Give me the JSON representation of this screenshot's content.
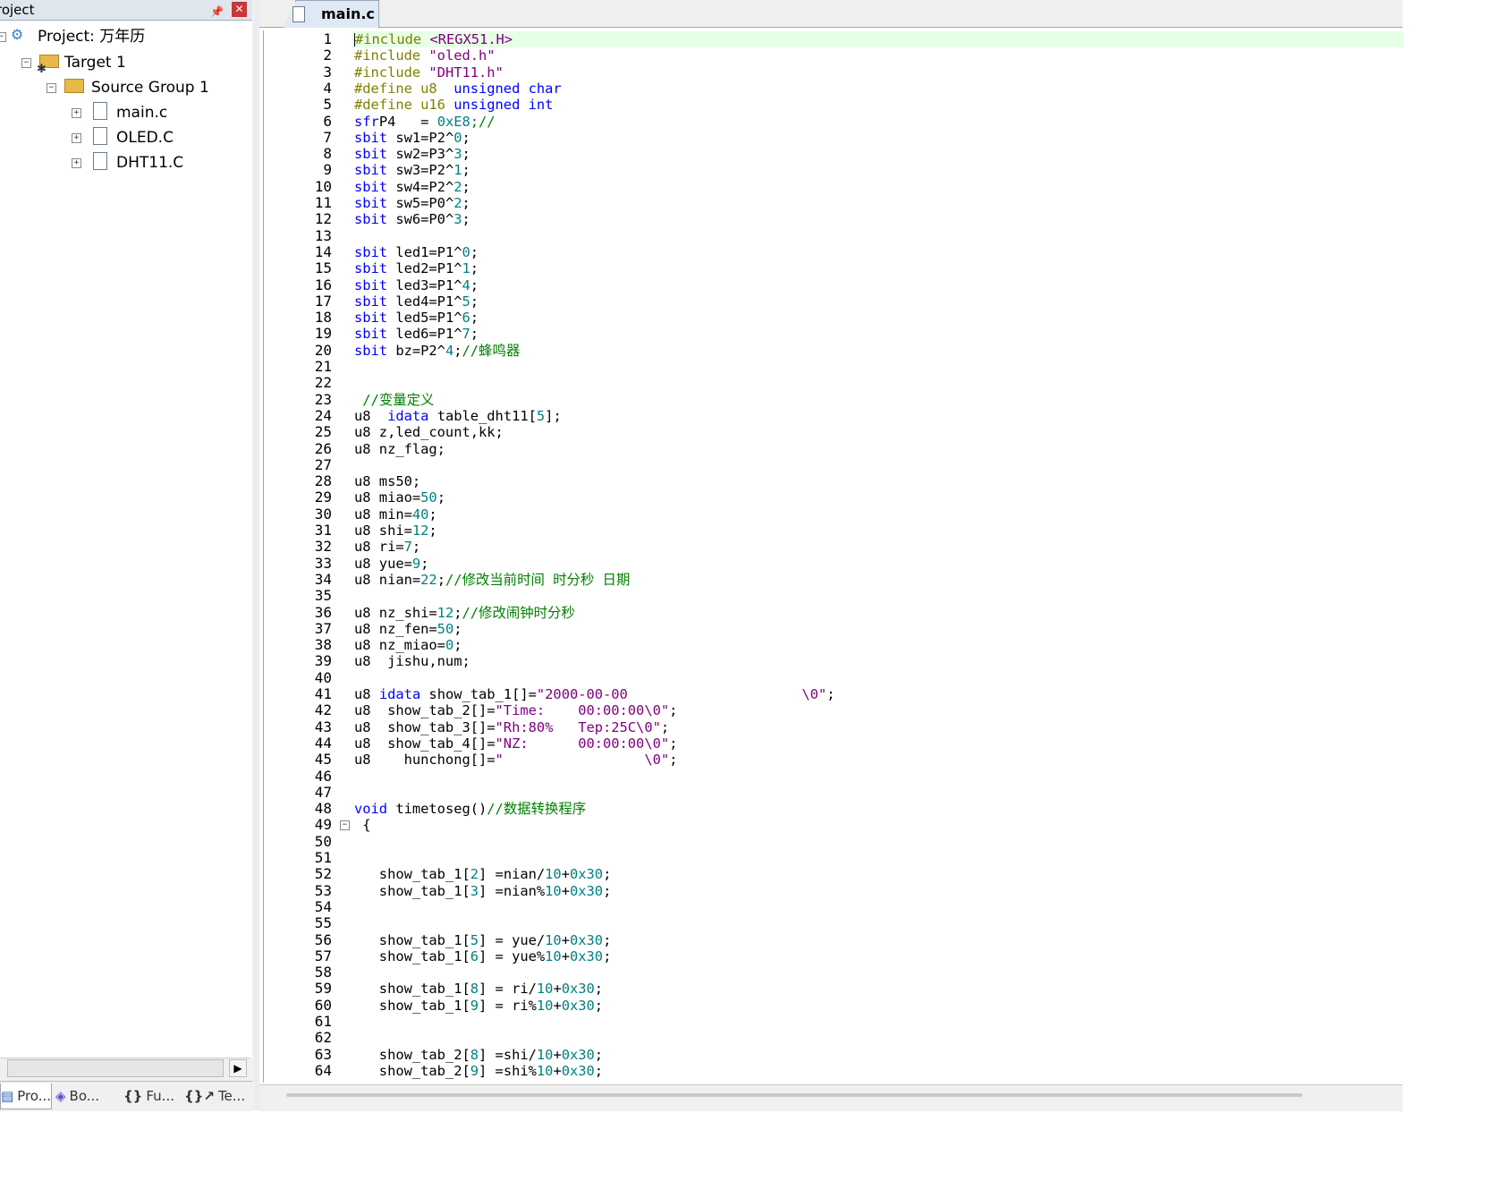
{
  "project_panel": {
    "title": "roject",
    "pin_icon": "pin-icon",
    "close_icon": "close-icon",
    "tree": {
      "project": "Project: 万年历",
      "target": "Target 1",
      "group": "Source Group 1",
      "files": [
        "main.c",
        "OLED.C",
        "DHT11.C"
      ]
    },
    "bottom_tabs": [
      "Pro...",
      "Bo...",
      "Fu...",
      "Te..."
    ],
    "bottom_tab_icons": [
      "project-icon",
      "books-icon",
      "functions-icon",
      "templates-icon"
    ]
  },
  "editor": {
    "tab": "main.c",
    "active_line": 1,
    "lines": [
      [
        [
          "pp",
          "#include "
        ],
        [
          "st",
          "<REGX51.H>"
        ]
      ],
      [
        [
          "pp",
          "#include "
        ],
        [
          "st",
          "\"oled.h\""
        ]
      ],
      [
        [
          "pp",
          "#include "
        ],
        [
          "st",
          "\"DHT11.h\""
        ]
      ],
      [
        [
          "pp",
          "#define u8  "
        ],
        [
          "kw",
          "unsigned char"
        ]
      ],
      [
        [
          "pp",
          "#define u16 "
        ],
        [
          "kw",
          "unsigned int"
        ]
      ],
      [
        [
          "kw",
          "sfr"
        ],
        [
          "",
          "P4   = "
        ],
        [
          "nm",
          "0xE8"
        ],
        [
          "cm",
          ";//"
        ]
      ],
      [
        [
          "kw",
          "sbit"
        ],
        [
          "",
          " sw1=P2^"
        ],
        [
          "nm",
          "0"
        ],
        [
          "",
          ";"
        ]
      ],
      [
        [
          "kw",
          "sbit"
        ],
        [
          "",
          " sw2=P3^"
        ],
        [
          "nm",
          "3"
        ],
        [
          "",
          ";"
        ]
      ],
      [
        [
          "kw",
          "sbit"
        ],
        [
          "",
          " sw3=P2^"
        ],
        [
          "nm",
          "1"
        ],
        [
          "",
          ";"
        ]
      ],
      [
        [
          "kw",
          "sbit"
        ],
        [
          "",
          " sw4=P2^"
        ],
        [
          "nm",
          "2"
        ],
        [
          "",
          ";"
        ]
      ],
      [
        [
          "kw",
          "sbit"
        ],
        [
          "",
          " sw5=P0^"
        ],
        [
          "nm",
          "2"
        ],
        [
          "",
          ";"
        ]
      ],
      [
        [
          "kw",
          "sbit"
        ],
        [
          "",
          " sw6=P0^"
        ],
        [
          "nm",
          "3"
        ],
        [
          "",
          ";"
        ]
      ],
      [],
      [
        [
          "kw",
          "sbit"
        ],
        [
          "",
          " led1=P1^"
        ],
        [
          "nm",
          "0"
        ],
        [
          "",
          ";"
        ]
      ],
      [
        [
          "kw",
          "sbit"
        ],
        [
          "",
          " led2=P1^"
        ],
        [
          "nm",
          "1"
        ],
        [
          "",
          ";"
        ]
      ],
      [
        [
          "kw",
          "sbit"
        ],
        [
          "",
          " led3=P1^"
        ],
        [
          "nm",
          "4"
        ],
        [
          "",
          ";"
        ]
      ],
      [
        [
          "kw",
          "sbit"
        ],
        [
          "",
          " led4=P1^"
        ],
        [
          "nm",
          "5"
        ],
        [
          "",
          ";"
        ]
      ],
      [
        [
          "kw",
          "sbit"
        ],
        [
          "",
          " led5=P1^"
        ],
        [
          "nm",
          "6"
        ],
        [
          "",
          ";"
        ]
      ],
      [
        [
          "kw",
          "sbit"
        ],
        [
          "",
          " led6=P1^"
        ],
        [
          "nm",
          "7"
        ],
        [
          "",
          ";"
        ]
      ],
      [
        [
          "kw",
          "sbit"
        ],
        [
          "",
          " bz=P2^"
        ],
        [
          "nm",
          "4"
        ],
        [
          "",
          ";"
        ],
        [
          "cm",
          "//蜂鸣器"
        ]
      ],
      [],
      [],
      [
        [
          "",
          " "
        ],
        [
          "cm",
          "//变量定义"
        ]
      ],
      [
        [
          "",
          "u8  "
        ],
        [
          "kw",
          "idata"
        ],
        [
          "",
          " table_dht11["
        ],
        [
          "nm",
          "5"
        ],
        [
          "",
          "];"
        ]
      ],
      [
        [
          "",
          "u8 z,led_count,kk;"
        ]
      ],
      [
        [
          "",
          "u8 nz_flag;"
        ]
      ],
      [],
      [
        [
          "",
          "u8 ms50;"
        ]
      ],
      [
        [
          "",
          "u8 miao="
        ],
        [
          "nm",
          "50"
        ],
        [
          "",
          ";"
        ]
      ],
      [
        [
          "",
          "u8 min="
        ],
        [
          "nm",
          "40"
        ],
        [
          "",
          ";"
        ]
      ],
      [
        [
          "",
          "u8 shi="
        ],
        [
          "nm",
          "12"
        ],
        [
          "",
          ";"
        ]
      ],
      [
        [
          "",
          "u8 ri="
        ],
        [
          "nm",
          "7"
        ],
        [
          "",
          ";"
        ]
      ],
      [
        [
          "",
          "u8 yue="
        ],
        [
          "nm",
          "9"
        ],
        [
          "",
          ";"
        ]
      ],
      [
        [
          "",
          "u8 nian="
        ],
        [
          "nm",
          "22"
        ],
        [
          "",
          ";"
        ],
        [
          "cm",
          "//修改当前时间 时分秒 日期"
        ]
      ],
      [],
      [
        [
          "",
          "u8 nz_shi="
        ],
        [
          "nm",
          "12"
        ],
        [
          "",
          ";"
        ],
        [
          "cm",
          "//修改闹钟时分秒"
        ]
      ],
      [
        [
          "",
          "u8 nz_fen="
        ],
        [
          "nm",
          "50"
        ],
        [
          "",
          ";"
        ]
      ],
      [
        [
          "",
          "u8 nz_miao="
        ],
        [
          "nm",
          "0"
        ],
        [
          "",
          ";"
        ]
      ],
      [
        [
          "",
          "u8  jishu,num;"
        ]
      ],
      [],
      [
        [
          "",
          "u8 "
        ],
        [
          "kw",
          "idata"
        ],
        [
          "",
          " show_tab_1[]="
        ],
        [
          "st",
          "\"2000-00-00                     \\0\""
        ],
        [
          "",
          ";"
        ]
      ],
      [
        [
          "",
          "u8  show_tab_2[]="
        ],
        [
          "st",
          "\"Time:    00:00:00\\0\""
        ],
        [
          "",
          ";"
        ]
      ],
      [
        [
          "",
          "u8  show_tab_3[]="
        ],
        [
          "st",
          "\"Rh:80%   Tep:25C\\0\""
        ],
        [
          "",
          ";"
        ]
      ],
      [
        [
          "",
          "u8  show_tab_4[]="
        ],
        [
          "st",
          "\"NZ:      00:00:00\\0\""
        ],
        [
          "",
          ";"
        ]
      ],
      [
        [
          "",
          "u8    hunchong[]="
        ],
        [
          "st",
          "\"                 \\0\""
        ],
        [
          "",
          ";"
        ]
      ],
      [],
      [],
      [
        [
          "kw",
          "void"
        ],
        [
          "",
          " timetoseg()"
        ],
        [
          "cm",
          "//数据转换程序"
        ]
      ],
      [
        [
          "",
          " {"
        ]
      ],
      [],
      [],
      [
        [
          "",
          "   show_tab_1["
        ],
        [
          "nm",
          "2"
        ],
        [
          "",
          "] =nian/"
        ],
        [
          "nm",
          "10"
        ],
        [
          "",
          "+"
        ],
        [
          "nm",
          "0x30"
        ],
        [
          "",
          ";"
        ]
      ],
      [
        [
          "",
          "   show_tab_1["
        ],
        [
          "nm",
          "3"
        ],
        [
          "",
          "] =nian%"
        ],
        [
          "nm",
          "10"
        ],
        [
          "",
          "+"
        ],
        [
          "nm",
          "0x30"
        ],
        [
          "",
          ";"
        ]
      ],
      [],
      [],
      [
        [
          "",
          "   show_tab_1["
        ],
        [
          "nm",
          "5"
        ],
        [
          "",
          "] = yue/"
        ],
        [
          "nm",
          "10"
        ],
        [
          "",
          "+"
        ],
        [
          "nm",
          "0x30"
        ],
        [
          "",
          ";"
        ]
      ],
      [
        [
          "",
          "   show_tab_1["
        ],
        [
          "nm",
          "6"
        ],
        [
          "",
          "] = yue%"
        ],
        [
          "nm",
          "10"
        ],
        [
          "",
          "+"
        ],
        [
          "nm",
          "0x30"
        ],
        [
          "",
          ";"
        ]
      ],
      [],
      [
        [
          "",
          "   show_tab_1["
        ],
        [
          "nm",
          "8"
        ],
        [
          "",
          "] = ri/"
        ],
        [
          "nm",
          "10"
        ],
        [
          "",
          "+"
        ],
        [
          "nm",
          "0x30"
        ],
        [
          "",
          ";"
        ]
      ],
      [
        [
          "",
          "   show_tab_1["
        ],
        [
          "nm",
          "9"
        ],
        [
          "",
          "] = ri%"
        ],
        [
          "nm",
          "10"
        ],
        [
          "",
          "+"
        ],
        [
          "nm",
          "0x30"
        ],
        [
          "",
          ";"
        ]
      ],
      [],
      [],
      [
        [
          "",
          "   show_tab_2["
        ],
        [
          "nm",
          "8"
        ],
        [
          "",
          "] =shi/"
        ],
        [
          "nm",
          "10"
        ],
        [
          "",
          "+"
        ],
        [
          "nm",
          "0x30"
        ],
        [
          "",
          ";"
        ]
      ],
      [
        [
          "",
          "   show_tab_2["
        ],
        [
          "nm",
          "9"
        ],
        [
          "",
          "] =shi%"
        ],
        [
          "nm",
          "10"
        ],
        [
          "",
          "+"
        ],
        [
          "nm",
          "0x30"
        ],
        [
          "",
          ";"
        ]
      ]
    ],
    "fold_line": 49,
    "colors": {
      "keyword": "#0000ff",
      "preprocessor": "#808000",
      "string": "#800080",
      "number": "#008080",
      "comment": "#008000",
      "current_line": "#e6ffe6"
    }
  }
}
